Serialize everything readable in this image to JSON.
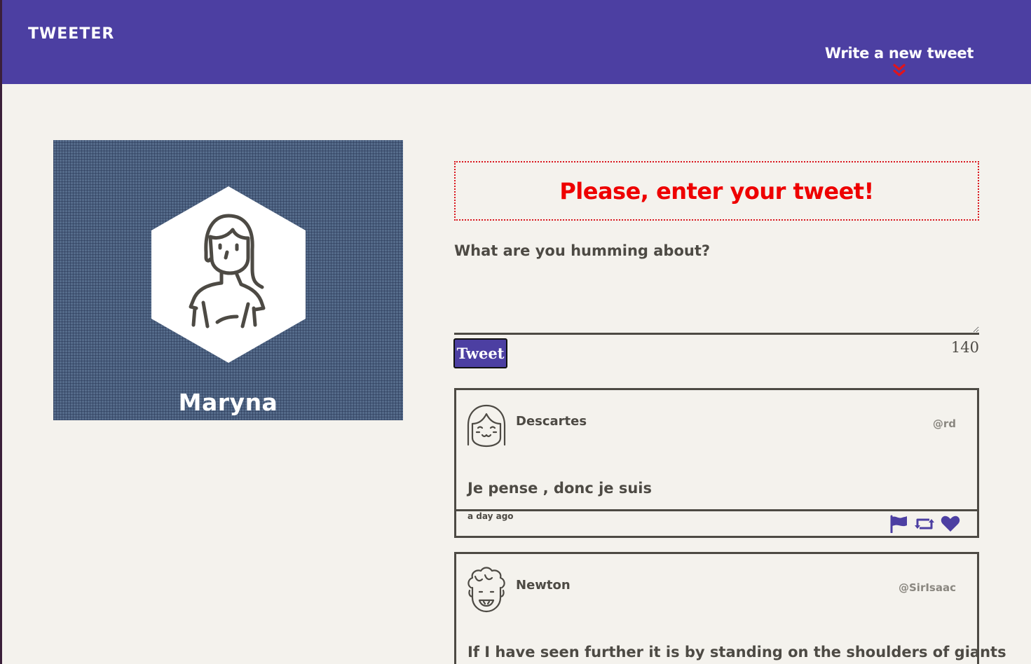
{
  "nav": {
    "brand": "TWEETER",
    "compose_toggle": "Write a new tweet"
  },
  "profile": {
    "name": "Maryna"
  },
  "compose": {
    "error": "Please, enter your tweet!",
    "placeholder": "What are you humming about?",
    "button": "Tweet",
    "counter": "140"
  },
  "tweets": [
    {
      "name": "Descartes",
      "handle": "@rd",
      "content": "Je pense , donc je suis",
      "time": "a day ago"
    },
    {
      "name": "Newton",
      "handle": "@SirIsaac",
      "content": "If I have seen further it is by standing on the shoulders of giants"
    }
  ],
  "icons": {
    "compose_toggle": "double-chevron-down-icon",
    "flag": "flag-icon",
    "retweet": "retweet-icon",
    "like": "heart-icon"
  },
  "colors": {
    "nav_bg": "#4c3fa2",
    "page_bg": "#f4f2ed",
    "error": "#ee0000",
    "text": "#4d4a44",
    "accent_icon": "#4c3fa2",
    "chevron": "#e0141c"
  }
}
